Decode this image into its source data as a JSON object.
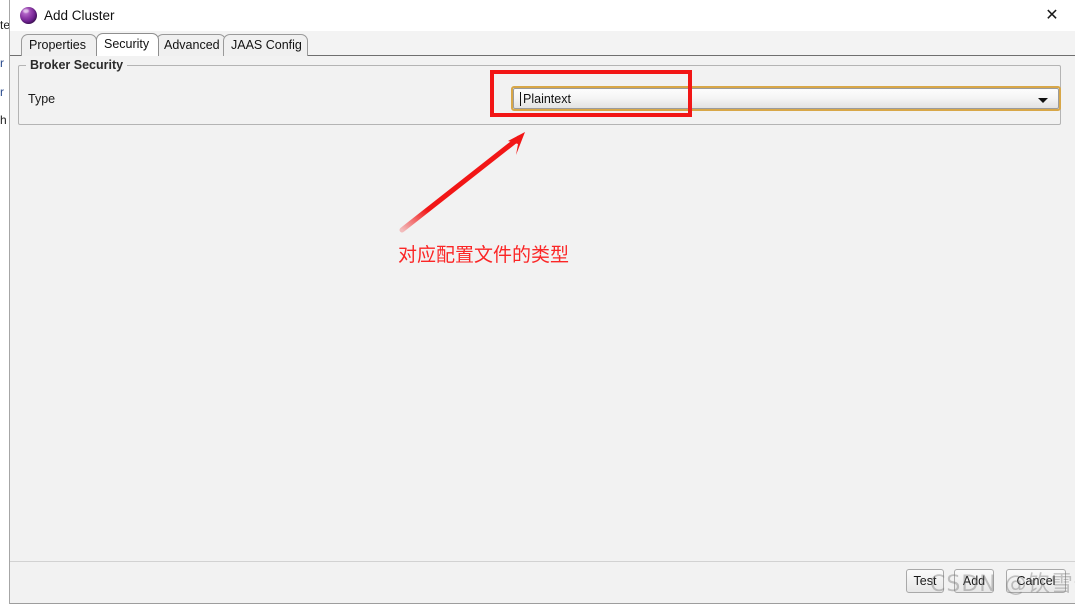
{
  "window": {
    "title": "Add Cluster",
    "icon": "cluster-sphere-icon",
    "close_label": "✕"
  },
  "tabs": [
    {
      "label": "Properties",
      "selected": false
    },
    {
      "label": "Security",
      "selected": true
    },
    {
      "label": "Advanced",
      "selected": false
    },
    {
      "label": "JAAS Config",
      "selected": false
    }
  ],
  "group": {
    "title": "Broker Security",
    "field_label": "Type"
  },
  "combobox": {
    "value": "Plaintext",
    "placeholder": "Plaintext",
    "arrow": "chevron-down-icon"
  },
  "annotation": {
    "text": "对应配置文件的类型",
    "color": "#fb2626",
    "box_color": "#f21616"
  },
  "buttons": {
    "test": "Test",
    "add": "Add",
    "cancel": "Cancel"
  },
  "watermark": {
    "text": "CSDN @饮雪煮茶"
  },
  "background_window": {
    "fragments": [
      "te",
      "r",
      "r",
      "h"
    ]
  },
  "colors": {
    "accent_border": "#d8a748",
    "dialog_bg": "#f2f2f2",
    "titlebar_bg": "#ffffff",
    "annotation_red": "#f21616"
  }
}
